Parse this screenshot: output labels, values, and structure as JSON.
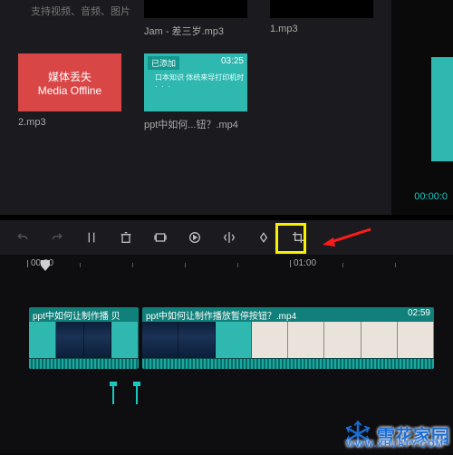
{
  "hint": "支持视频、音频、图片",
  "media": {
    "jam": {
      "caption": "Jam - 差三岁.mp3"
    },
    "one": {
      "caption": "1.mp3"
    },
    "offline": {
      "line1": "媒体丢失",
      "line2": "Media Offline",
      "caption": "2.mp3"
    },
    "ppt": {
      "badge": "已添加",
      "dur": "03:25",
      "caption": "ppt中如何...钮？.mp4"
    }
  },
  "timecode": "00:00:0",
  "ruler": {
    "t00": "00:00",
    "t01": "01:00"
  },
  "clips": {
    "a": {
      "label": "ppt中如何让制作播 贝"
    },
    "b": {
      "label": "ppt中如何让制作播放暂停按钮？.mp4",
      "dur": "02:59"
    }
  },
  "watermark": {
    "title": "雪花家园",
    "sub": "WWW.XHJATY.COM"
  }
}
